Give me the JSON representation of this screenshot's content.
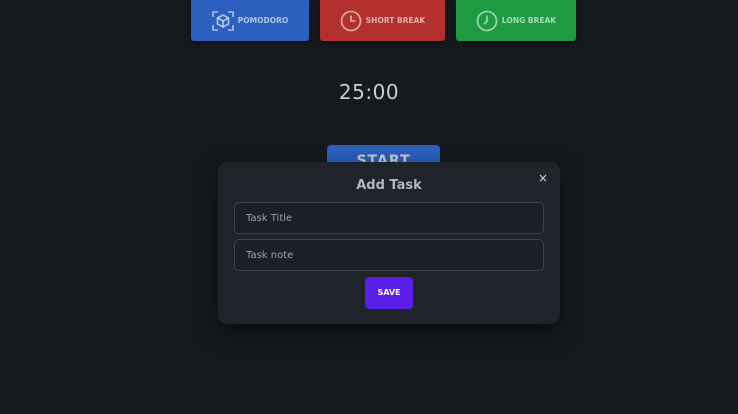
{
  "colors": {
    "background": "#16191e",
    "pomodoro": "#2d5fbf",
    "short_break": "#b3302f",
    "long_break": "#1e9a43",
    "start": "#2d5fbf",
    "modal": "#1f232a",
    "save": "#5b1de8"
  },
  "modes": [
    {
      "label": "POMODORO",
      "icon": "pomodoro-cube-icon"
    },
    {
      "label": "SHORT BREAK",
      "icon": "clock-icon"
    },
    {
      "label": "LONG BREAK",
      "icon": "clock-icon"
    }
  ],
  "timer": {
    "display": "25:00"
  },
  "start_button": {
    "label": "START"
  },
  "modal": {
    "title": "Add Task",
    "close_label": "×",
    "task_title_placeholder": "Task Title",
    "task_note_placeholder": "Task note",
    "save_label": "SAVE"
  }
}
